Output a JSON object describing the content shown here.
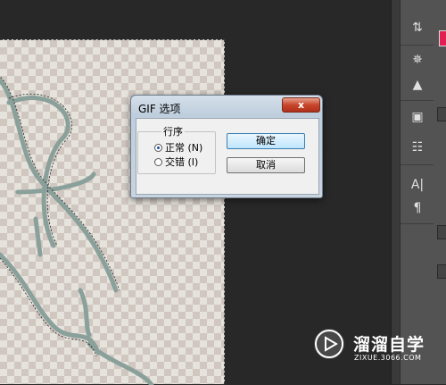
{
  "dialog": {
    "title": "GIF 选项",
    "close_glyph": "x",
    "group_label": "行序",
    "radio_normal_label": "正常 (N)",
    "radio_interlaced_label": "交错 (I)",
    "selected": "正常 (N)",
    "ok_label": "确定",
    "cancel_label": "取消"
  },
  "toolbar": {
    "icons": [
      "history-icon",
      "compass-icon",
      "histogram-icon",
      "layer-comp-icon",
      "adjust-icon",
      "character-icon",
      "paragraph-icon"
    ],
    "character_glyph": "A|",
    "paragraph_glyph": "¶"
  },
  "colors": {
    "foreground": "#e02052",
    "workspace": "#282828",
    "panel": "#535353"
  },
  "watermark": {
    "brand": "溜溜自学",
    "url": "ZIXUE.3066.COM"
  }
}
